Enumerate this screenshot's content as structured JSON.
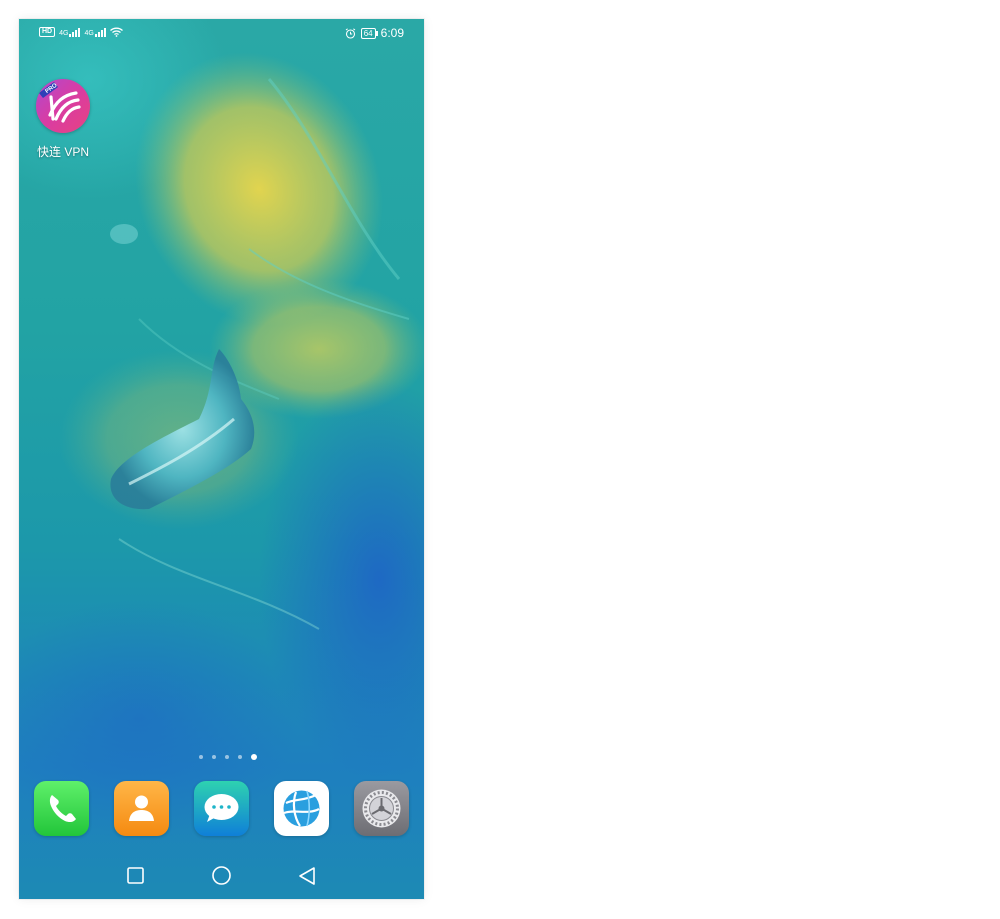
{
  "status_bar": {
    "hd_badge": "HD",
    "sim1_network": "4G",
    "sim2_network": "4G",
    "battery": "64",
    "time": "6:09"
  },
  "desktop": {
    "apps": [
      {
        "label": "快连 VPN",
        "icon": "vpn-pro-icon"
      }
    ],
    "page_indicator": {
      "pages": 5,
      "active_index": 4
    }
  },
  "dock": [
    {
      "icon": "phone-icon",
      "color": "#3ddc4e"
    },
    {
      "icon": "contacts-icon",
      "color": "#ff9e1e"
    },
    {
      "icon": "messages-icon",
      "color": "#1fb5c9"
    },
    {
      "icon": "browser-icon",
      "color": "#1a8fd8"
    },
    {
      "icon": "settings-icon",
      "color": "#8e8e93"
    }
  ],
  "navigation": [
    "recent-apps-icon",
    "home-icon",
    "back-icon"
  ],
  "colors": {
    "wallpaper_teal": "#1fa7ad",
    "wallpaper_yellow": "#d9cf4a",
    "wallpaper_blue": "#1b6fc2"
  }
}
